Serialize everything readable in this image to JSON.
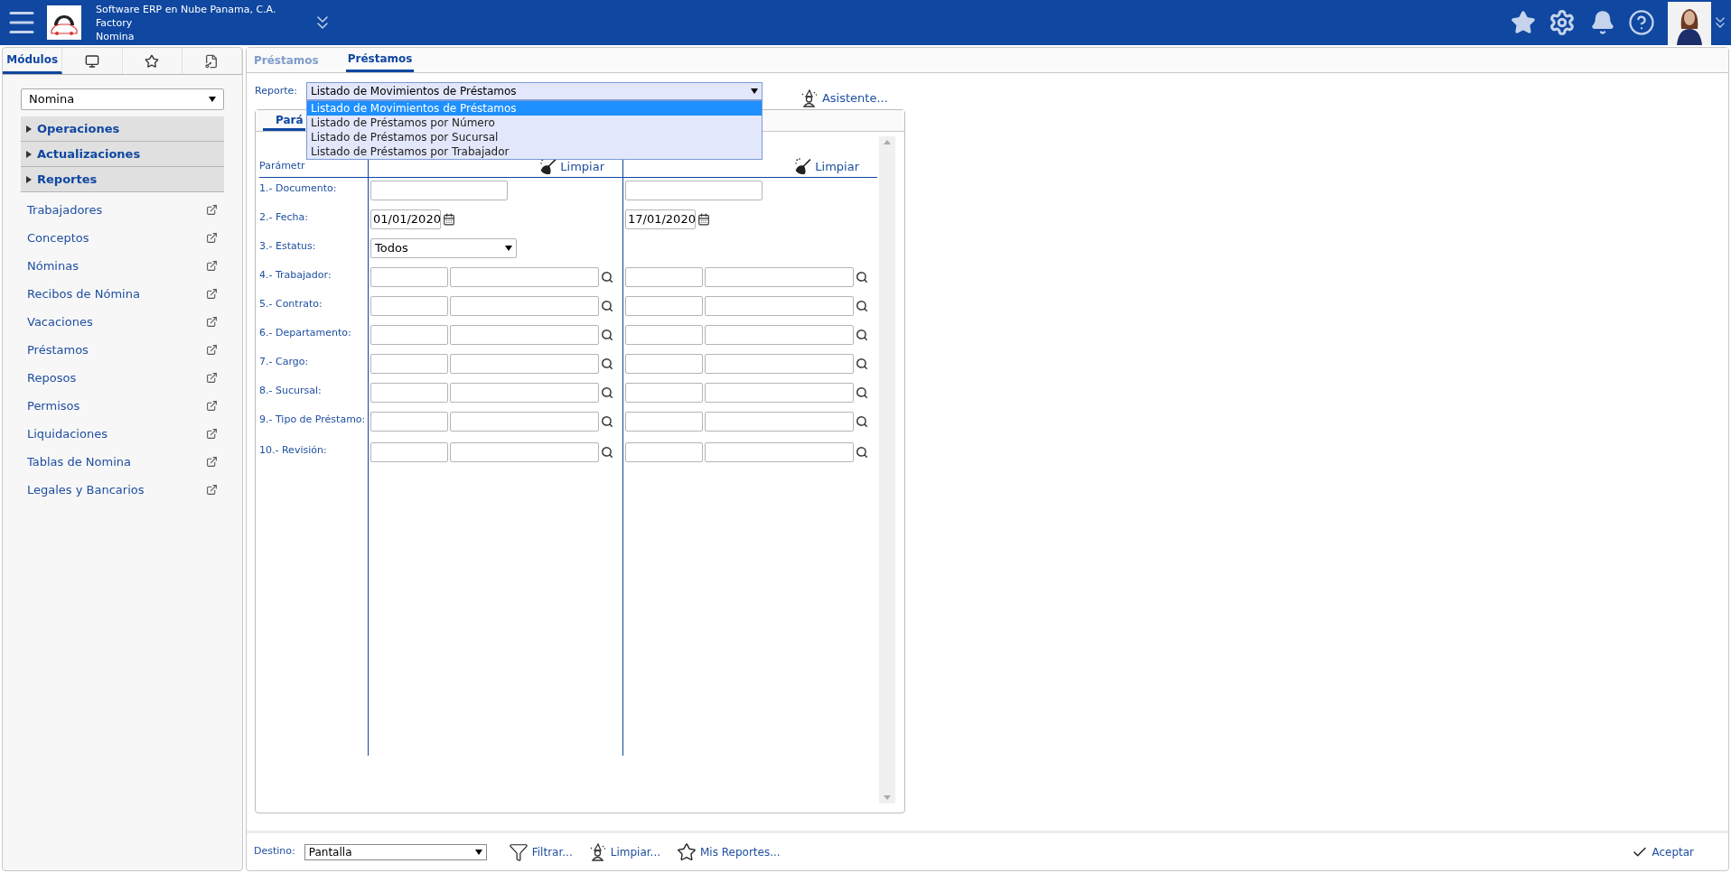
{
  "header": {
    "company_lines": [
      "Software ERP en Nube Panama, C.A.",
      "Factory",
      "Nomina"
    ]
  },
  "sidebar": {
    "tabs": [
      {
        "kind": "text",
        "label": "Módulos",
        "selected": true
      },
      {
        "kind": "monitor",
        "selected": false
      },
      {
        "kind": "star",
        "selected": false
      },
      {
        "kind": "key",
        "selected": false
      }
    ],
    "module_select": "Nomina",
    "sections": [
      {
        "label": "Operaciones",
        "expanded": false
      },
      {
        "label": "Actualizaciones",
        "expanded": false
      },
      {
        "label": "Reportes",
        "expanded": false
      }
    ],
    "links": [
      "Trabajadores",
      "Conceptos",
      "Nóminas",
      "Recibos de Nómina",
      "Vacaciones",
      "Préstamos",
      "Reposos",
      "Permisos",
      "Liquidaciones",
      "Tablas de Nomina",
      "Legales y Bancarios"
    ]
  },
  "tabs": [
    {
      "label": "Préstamos",
      "selected": false
    },
    {
      "label": "Préstamos",
      "selected": true
    }
  ],
  "report": {
    "label": "Reporte:",
    "value": "Listado de Movimientos de Préstamos",
    "assistant": "Asistente...",
    "options": [
      {
        "label": "Listado de Movimientos de Préstamos",
        "selected": true
      },
      {
        "label": "Listado de Préstamos por Número",
        "selected": false
      },
      {
        "label": "Listado de Préstamos por Sucursal",
        "selected": false
      },
      {
        "label": "Listado de Préstamos por Trabajador",
        "selected": false
      }
    ]
  },
  "panel": {
    "tab": {
      "label": "Pará",
      "selected": true
    },
    "params_label": "Parámetr",
    "clear_buttons": [
      "Limpiar",
      "Limpiar"
    ],
    "rows": [
      {
        "label": "1.- Documento:",
        "kind": "text"
      },
      {
        "label": "2.- Fecha:",
        "kind": "date",
        "from": "01/01/2020",
        "to": "17/01/2020"
      },
      {
        "label": "3.- Estatus:",
        "kind": "select",
        "from": "Todos"
      },
      {
        "label": "4.- Trabajador:",
        "kind": "lookup"
      },
      {
        "label": "5.- Contrato:",
        "kind": "lookup"
      },
      {
        "label": "6.- Departamento:",
        "kind": "lookup"
      },
      {
        "label": "7.- Cargo:",
        "kind": "lookup"
      },
      {
        "label": "8.- Sucursal:",
        "kind": "lookup"
      },
      {
        "label": "9.- Tipo de Préstamo:",
        "kind": "lookup"
      },
      {
        "label": "10.- Revisión:",
        "kind": "lookup"
      }
    ]
  },
  "footer": {
    "destination_label": "Destino:",
    "destination": "Pantalla",
    "actions": [
      {
        "kind": "filter",
        "label": "Filtrar..."
      },
      {
        "kind": "broom",
        "label": "Limpiar..."
      },
      {
        "kind": "star",
        "label": "Mis Reportes..."
      }
    ],
    "accept": "Aceptar"
  }
}
